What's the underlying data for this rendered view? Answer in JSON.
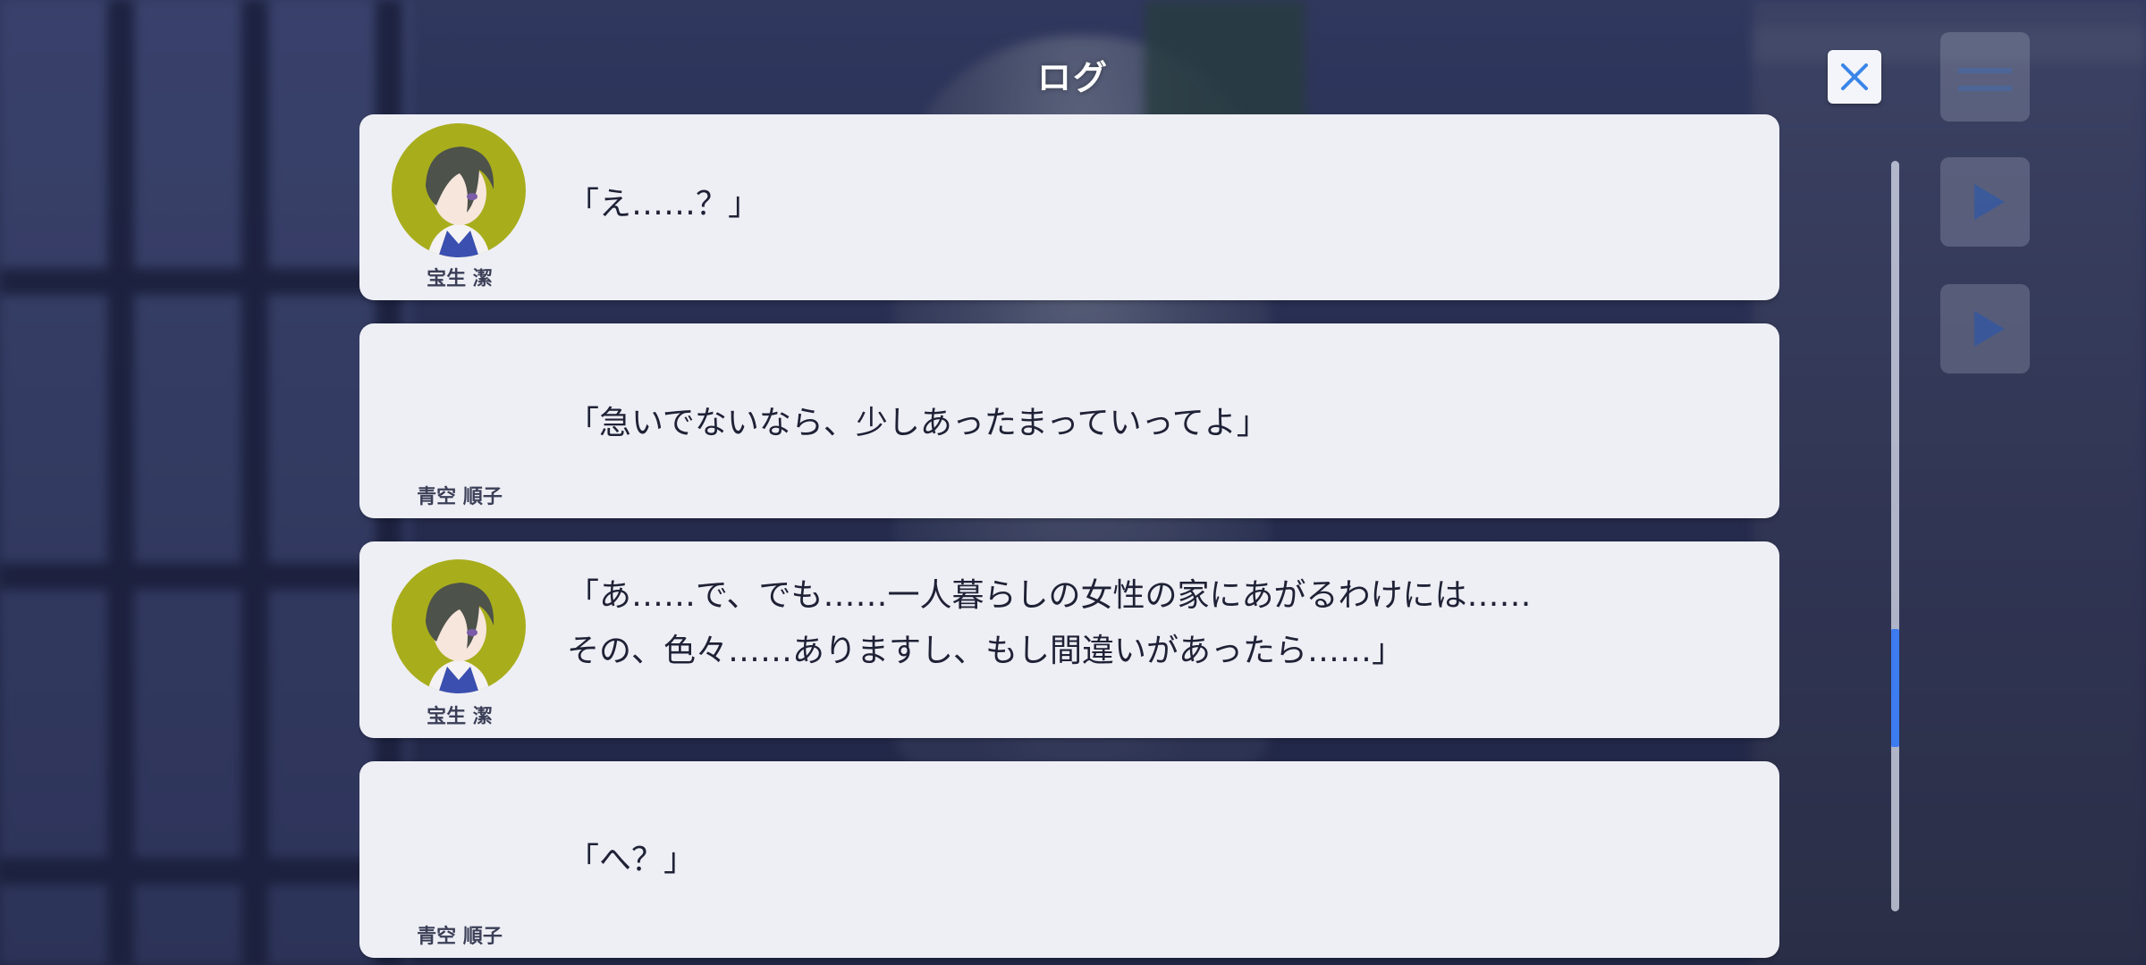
{
  "header": {
    "title": "ログ",
    "close_icon": "close-icon"
  },
  "log_entries": [
    {
      "speaker": "宝生 潔",
      "has_avatar": true,
      "text": "「え……？」"
    },
    {
      "speaker": "青空 順子",
      "has_avatar": false,
      "text": "「急いでないなら、少しあったまっていってよ」"
    },
    {
      "speaker": "宝生 潔",
      "has_avatar": true,
      "text": "「あ……で、でも……一人暮らしの女性の家にあがるわけには……\nその、色々……ありますし、もし間違いがあったら……」"
    },
    {
      "speaker": "青空 順子",
      "has_avatar": false,
      "text": "「へ？」"
    }
  ],
  "scroll": {
    "position_fraction": 0.74
  },
  "colors": {
    "panel": "#eeeff5",
    "avatar_bg": "#a8ad1c",
    "accent": "#3d7bf0"
  }
}
